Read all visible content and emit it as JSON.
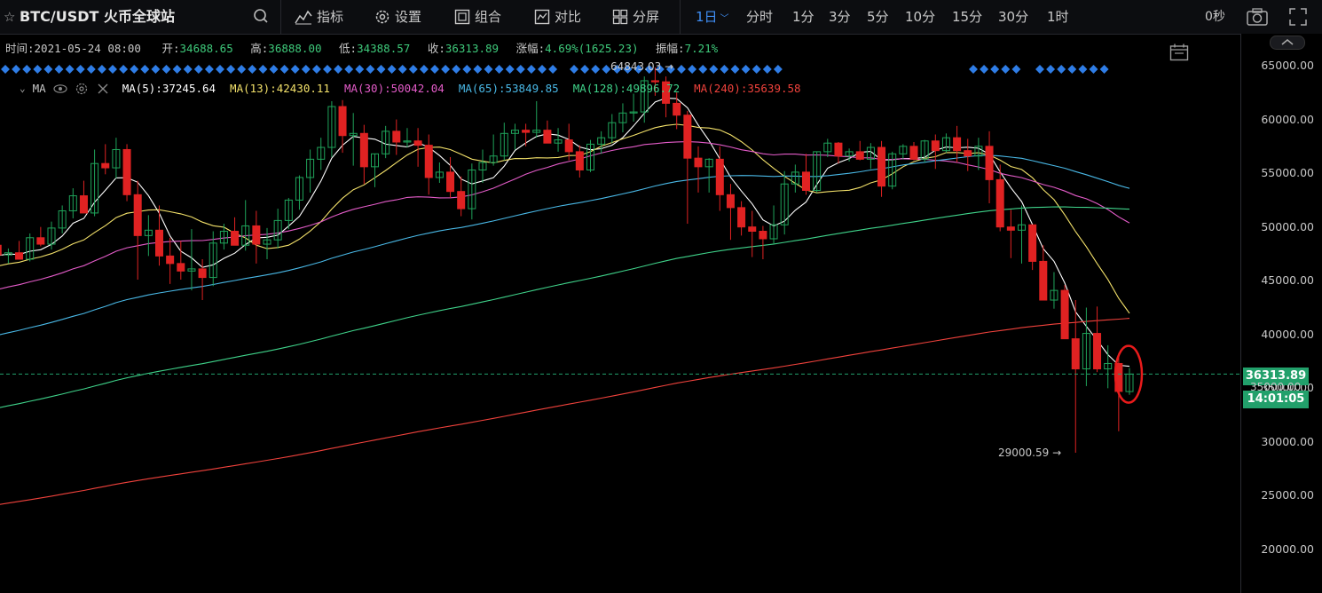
{
  "toolbar": {
    "symbol": "BTC/USDT 火币全球站",
    "tools": [
      "指标",
      "设置",
      "组合",
      "对比",
      "分屏"
    ],
    "intervals": [
      "1日",
      "分时",
      "1分",
      "3分",
      "5分",
      "10分",
      "15分",
      "30分",
      "1时"
    ],
    "active_interval": "1日",
    "countdown": "0秒"
  },
  "ohlc": {
    "time_label": "时间:",
    "time": "2021-05-24 08:00",
    "open_label": "开:",
    "open": "34688.65",
    "high_label": "高:",
    "high": "36888.00",
    "low_label": "低:",
    "low": "34388.57",
    "close_label": "收:",
    "close": "36313.89",
    "change_label": "涨幅:",
    "change": "4.69%(1625.23)",
    "amp_label": "振幅:",
    "amp": "7.21%"
  },
  "ma_legend": {
    "title": "MA",
    "items": [
      {
        "label": "MA(5):37245.64",
        "color": "#ffffff"
      },
      {
        "label": "MA(13):42430.11",
        "color": "#f3e16a"
      },
      {
        "label": "MA(30):50042.04",
        "color": "#e35bc8"
      },
      {
        "label": "MA(65):53849.85",
        "color": "#49b8e6"
      },
      {
        "label": "MA(128):49896.72",
        "color": "#3fd38a"
      },
      {
        "label": "MA(240):35639.58",
        "color": "#f0423c"
      }
    ]
  },
  "price_tag": "36313.89",
  "price_tag_under": "35000.00",
  "time_tag": "14:01:05",
  "chart_data": {
    "type": "candlestick",
    "ylim": [
      17000,
      67500
    ],
    "y_ticks": [
      20000,
      25000,
      30000,
      35000,
      40000,
      45000,
      50000,
      55000,
      60000,
      65000
    ],
    "y_tick_labels": [
      "20000.00",
      "25000.00",
      "30000.00",
      "35000.00",
      "40000.00",
      "45000.00",
      "50000.00",
      "55000.00",
      "60000.00",
      "65000.00"
    ],
    "high_annotation": "64843.03 →",
    "high_value": 64843.03,
    "low_annotation": "29000.59 →",
    "low_value": 29000.59,
    "last_price": 36313.89,
    "up_color": "#1fa35a",
    "down_color": "#e02222",
    "candles": [
      [
        48300,
        48600,
        47200,
        47400
      ],
      [
        47400,
        48000,
        46600,
        47600
      ],
      [
        47600,
        48700,
        47100,
        47000
      ],
      [
        47000,
        49400,
        46800,
        49000
      ],
      [
        49000,
        50000,
        48200,
        48400
      ],
      [
        48400,
        50500,
        47900,
        49900
      ],
      [
        49900,
        52000,
        49400,
        51500
      ],
      [
        51500,
        53600,
        50800,
        52900
      ],
      [
        52900,
        54300,
        51900,
        51300
      ],
      [
        51300,
        57200,
        51000,
        55900
      ],
      [
        55900,
        57700,
        54900,
        55500
      ],
      [
        55500,
        58300,
        54500,
        57200
      ],
      [
        57200,
        57700,
        52400,
        53000
      ],
      [
        53000,
        54300,
        45100,
        49200
      ],
      [
        49200,
        51100,
        47300,
        49700
      ],
      [
        49700,
        52000,
        46400,
        47300
      ],
      [
        47300,
        49000,
        44700,
        46600
      ],
      [
        46600,
        48700,
        45100,
        45900
      ],
      [
        45900,
        49800,
        44100,
        46100
      ],
      [
        46100,
        47000,
        43200,
        45300
      ],
      [
        45300,
        49600,
        44500,
        48500
      ],
      [
        48500,
        50300,
        47900,
        49600
      ],
      [
        49600,
        50900,
        48300,
        48300
      ],
      [
        48300,
        52500,
        47800,
        50100
      ],
      [
        50100,
        51500,
        46600,
        48400
      ],
      [
        48400,
        49900,
        47000,
        48800
      ],
      [
        48800,
        51700,
        48000,
        50600
      ],
      [
        50600,
        52700,
        49800,
        52500
      ],
      [
        52500,
        54800,
        51600,
        54600
      ],
      [
        54600,
        57200,
        53200,
        56300
      ],
      [
        56300,
        58300,
        55300,
        57400
      ],
      [
        57400,
        61700,
        56500,
        61200
      ],
      [
        61200,
        61800,
        56900,
        58500
      ],
      [
        58500,
        60600,
        55700,
        58700
      ],
      [
        58700,
        59500,
        54000,
        55600
      ],
      [
        55600,
        56800,
        53700,
        56800
      ],
      [
        56800,
        59400,
        56400,
        58900
      ],
      [
        58900,
        60000,
        56700,
        57900
      ],
      [
        57900,
        59200,
        57400,
        58000
      ],
      [
        58000,
        59200,
        55600,
        57600
      ],
      [
        57600,
        58600,
        53000,
        54600
      ],
      [
        54600,
        56000,
        54100,
        55100
      ],
      [
        55100,
        56500,
        52700,
        53300
      ],
      [
        53300,
        54700,
        51000,
        51700
      ],
      [
        51700,
        55900,
        50700,
        55300
      ],
      [
        55300,
        57200,
        54100,
        56000
      ],
      [
        56000,
        58600,
        55700,
        56600
      ],
      [
        56600,
        59700,
        56200,
        58700
      ],
      [
        58700,
        59600,
        57200,
        59000
      ],
      [
        59000,
        59600,
        57500,
        58800
      ],
      [
        58800,
        61700,
        58300,
        59000
      ],
      [
        59000,
        59900,
        58000,
        57800
      ],
      [
        57800,
        59200,
        57000,
        58100
      ],
      [
        58100,
        59600,
        56200,
        57000
      ],
      [
        57000,
        57600,
        54600,
        55300
      ],
      [
        55300,
        58100,
        55100,
        57700
      ],
      [
        57700,
        58900,
        56800,
        58300
      ],
      [
        58300,
        60500,
        57800,
        59700
      ],
      [
        59700,
        61500,
        58800,
        60600
      ],
      [
        60600,
        62400,
        59800,
        60700
      ],
      [
        60700,
        64000,
        59700,
        63600
      ],
      [
        63600,
        64843,
        62200,
        63500
      ],
      [
        63500,
        64000,
        60200,
        61500
      ],
      [
        61500,
        62500,
        59100,
        60400
      ],
      [
        60400,
        60800,
        50300,
        56400
      ],
      [
        56400,
        57500,
        53200,
        55600
      ],
      [
        55600,
        56400,
        53200,
        56300
      ],
      [
        56300,
        57500,
        51500,
        53000
      ],
      [
        53000,
        54000,
        48800,
        51800
      ],
      [
        51800,
        52400,
        49200,
        50000
      ],
      [
        50000,
        51500,
        47200,
        49600
      ],
      [
        49600,
        50100,
        47000,
        48900
      ],
      [
        48900,
        52000,
        48400,
        50200
      ],
      [
        50200,
        55200,
        49300,
        54000
      ],
      [
        54000,
        55800,
        53200,
        55100
      ],
      [
        55100,
        56800,
        53000,
        53400
      ],
      [
        53400,
        57000,
        53200,
        57000
      ],
      [
        57000,
        58200,
        56500,
        57800
      ],
      [
        57800,
        57900,
        55900,
        56600
      ],
      [
        56600,
        57300,
        56100,
        57000
      ],
      [
        57000,
        58000,
        56200,
        56300
      ],
      [
        56300,
        57800,
        55400,
        57400
      ],
      [
        57400,
        58000,
        52800,
        53800
      ],
      [
        53800,
        57000,
        53500,
        56800
      ],
      [
        56800,
        57700,
        56300,
        57500
      ],
      [
        57500,
        57900,
        56200,
        56300
      ],
      [
        56300,
        58100,
        56000,
        58000
      ],
      [
        58000,
        58600,
        55400,
        57100
      ],
      [
        57100,
        58700,
        56900,
        58300
      ],
      [
        58300,
        59400,
        56000,
        57100
      ],
      [
        57100,
        58200,
        55200,
        56600
      ],
      [
        56600,
        58300,
        55300,
        57500
      ],
      [
        57500,
        58900,
        52200,
        54400
      ],
      [
        54400,
        55800,
        49600,
        50000
      ],
      [
        50000,
        51600,
        47100,
        49700
      ],
      [
        49700,
        52000,
        46600,
        50200
      ],
      [
        50200,
        50200,
        46000,
        46800
      ],
      [
        46800,
        48300,
        43600,
        43200
      ],
      [
        43200,
        45800,
        42400,
        44100
      ],
      [
        44100,
        44600,
        40500,
        39600
      ],
      [
        39600,
        43200,
        29000.59,
        36800
      ],
      [
        36800,
        42500,
        35200,
        40100
      ],
      [
        40100,
        42600,
        36500,
        36800
      ],
      [
        36800,
        39000,
        35000,
        37300
      ],
      [
        37300,
        38000,
        31000,
        34700
      ],
      [
        34688.65,
        36888,
        34388.57,
        36313.89
      ]
    ],
    "ma_series": [
      {
        "period": 5,
        "color": "#ffffff"
      },
      {
        "period": 13,
        "color": "#f3e16a"
      },
      {
        "period": 30,
        "color": "#e35bc8"
      },
      {
        "period": 65,
        "color": "#49b8e6"
      },
      {
        "period": 128,
        "color": "#3fd38a"
      },
      {
        "period": 240,
        "color": "#f0423c"
      }
    ]
  }
}
